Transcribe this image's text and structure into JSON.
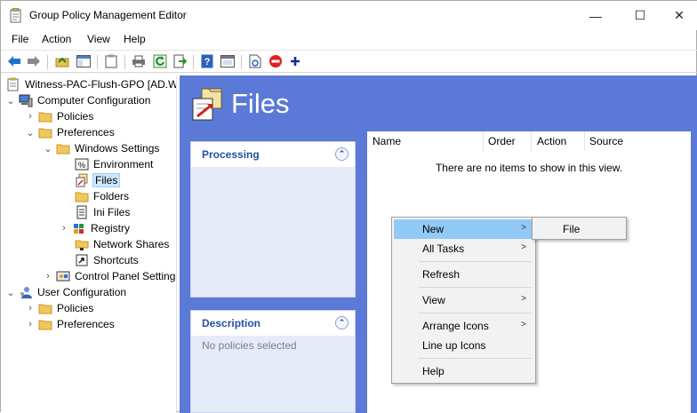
{
  "window": {
    "title": "Group Policy Management Editor",
    "controls": {
      "minimize": "—",
      "maximize": "☐",
      "close": "✕"
    }
  },
  "menubar": {
    "items": [
      "File",
      "Action",
      "View",
      "Help"
    ]
  },
  "toolbar": {
    "buttons": [
      "back-icon",
      "forward-icon",
      "up-folder-icon",
      "show-hide-tree-icon",
      "clipboard-icon",
      "print-icon",
      "refresh-icon",
      "export-icon",
      "help-icon",
      "properties-icon",
      "file-icon",
      "block-icon",
      "add-icon"
    ]
  },
  "tree": {
    "nodes": [
      {
        "label": "Witness-PAC-Flush-GPO [AD.W",
        "icon": "gpo-icon"
      },
      {
        "label": "Computer Configuration",
        "icon": "computer-icon",
        "expander": "v"
      },
      {
        "label": "Policies",
        "icon": "folder-icon",
        "expander": ">"
      },
      {
        "label": "Preferences",
        "icon": "folder-icon",
        "expander": "v"
      },
      {
        "label": "Windows Settings",
        "icon": "folder-icon",
        "expander": "v"
      },
      {
        "label": "Environment",
        "icon": "environment-icon"
      },
      {
        "label": "Files",
        "icon": "files-icon",
        "selected": true
      },
      {
        "label": "Folders",
        "icon": "folder-icon"
      },
      {
        "label": "Ini Files",
        "icon": "ini-icon"
      },
      {
        "label": "Registry",
        "icon": "registry-icon",
        "expander": ">"
      },
      {
        "label": "Network Shares",
        "icon": "network-share-icon"
      },
      {
        "label": "Shortcuts",
        "icon": "shortcut-icon"
      },
      {
        "label": "Control Panel Setting",
        "icon": "control-panel-icon",
        "expander": ">"
      },
      {
        "label": "User Configuration",
        "icon": "user-icon",
        "expander": "v"
      },
      {
        "label": "Policies",
        "icon": "folder-icon",
        "expander": ">"
      },
      {
        "label": "Preferences",
        "icon": "folder-icon",
        "expander": ">"
      }
    ]
  },
  "main": {
    "title": "Files",
    "processing": {
      "title": "Processing",
      "collapse": "⌃"
    },
    "description": {
      "title": "Description",
      "text": "No policies selected",
      "collapse": "⌃"
    },
    "list": {
      "columns": [
        "Name",
        "Order",
        "Action",
        "Source"
      ],
      "empty_text": "There are no items to show in this view."
    }
  },
  "context_menu": {
    "items": [
      {
        "label": "New",
        "arrow": ">"
      },
      {
        "label": "All Tasks",
        "arrow": ">"
      },
      {
        "label": "Refresh"
      },
      {
        "label": "View",
        "arrow": ">"
      },
      {
        "label": "Arrange Icons",
        "arrow": ">"
      },
      {
        "label": "Line up Icons"
      },
      {
        "label": "Help"
      }
    ],
    "submenu": {
      "items": [
        "File"
      ]
    }
  },
  "colors": {
    "main_bg": "#5b79d6",
    "panel_header_text": "#2350a8",
    "menu_hover": "#91c9f7",
    "tree_selection": "#cce8ff"
  }
}
